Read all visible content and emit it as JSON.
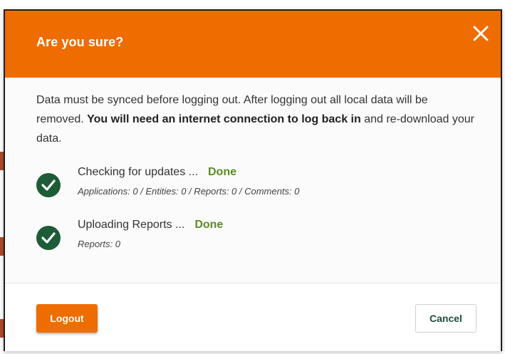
{
  "dialog": {
    "title": "Are you sure?",
    "close_icon": "close-icon",
    "message": {
      "part1": "Data must be synced before logging out. After logging out all local data will be removed. ",
      "bold": "You will need an internet connection to log back in",
      "part2": " and re-download your data."
    },
    "statuses": [
      {
        "label": "Checking for updates ...",
        "state": "Done",
        "detail": "Applications: 0 / Entities: 0 / Reports: 0 / Comments: 0",
        "icon": "check-circle-icon"
      },
      {
        "label": "Uploading Reports ...",
        "state": "Done",
        "detail": "Reports: 0",
        "icon": "check-circle-icon"
      }
    ],
    "buttons": {
      "logout": "Logout",
      "cancel": "Cancel"
    }
  },
  "colors": {
    "accent": "#ef6c00",
    "done": "#5b8b26",
    "check": "#1e5b37"
  }
}
